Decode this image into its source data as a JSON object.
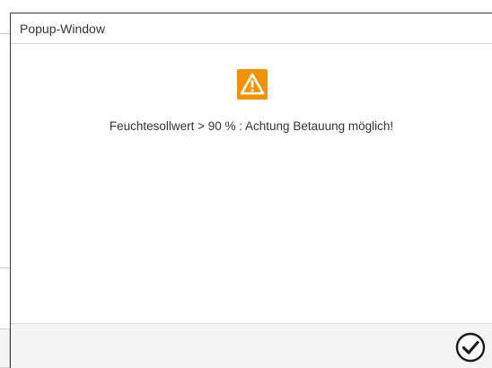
{
  "popup": {
    "title": "Popup-Window",
    "message": "Feuchtesollwert > 90 % : Achtung Betauung möglich!",
    "icon": "warning-icon",
    "icon_color": "#f39200",
    "confirm_icon": "checkmark-circle-icon"
  }
}
